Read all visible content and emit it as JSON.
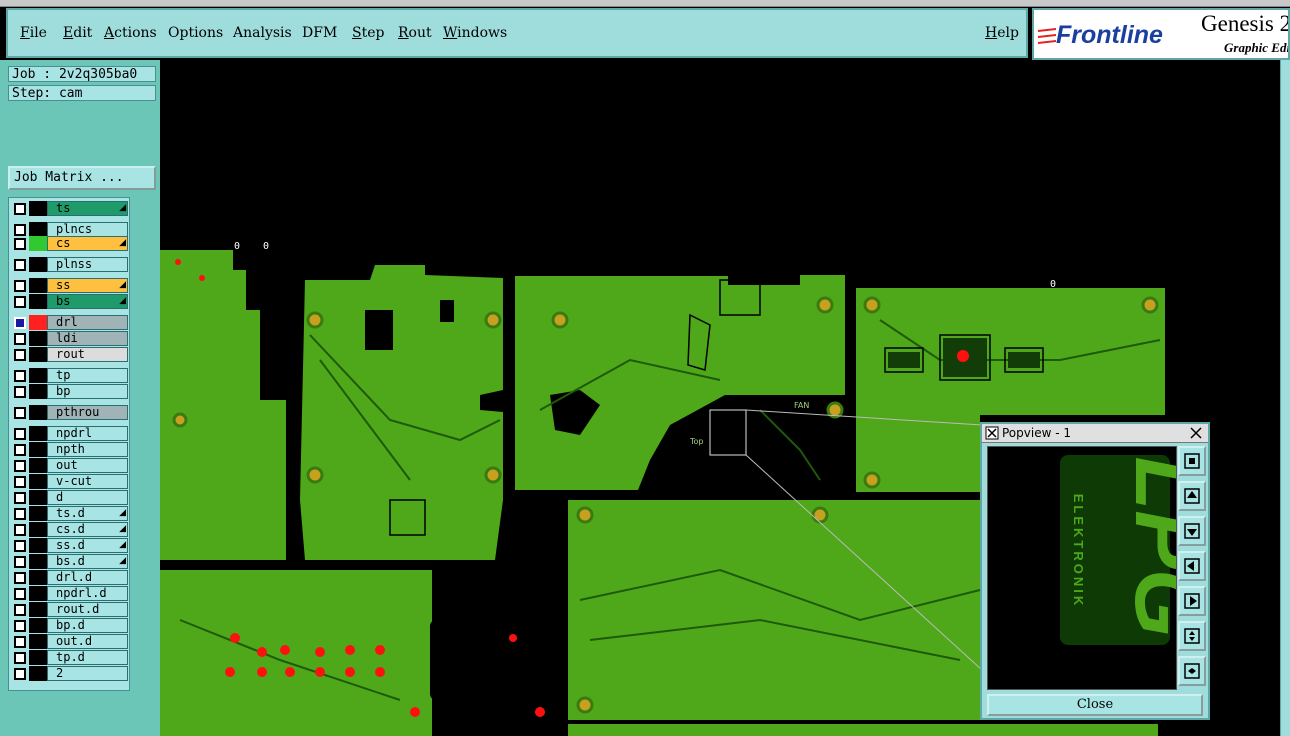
{
  "menubar": {
    "items": [
      {
        "label": "File"
      },
      {
        "label": "Edit"
      },
      {
        "label": "Actions"
      },
      {
        "label": "Options"
      },
      {
        "label": "Analysis"
      },
      {
        "label": "DFM"
      },
      {
        "label": "Step"
      },
      {
        "label": "Rout"
      },
      {
        "label": "Windows"
      }
    ],
    "help": "Help"
  },
  "brand": {
    "logo": "Frontline",
    "product": "Genesis 2",
    "subtitle": "Graphic Editor"
  },
  "job": {
    "label": "Job : 2v2q305ba0"
  },
  "step": {
    "label": "Step: cam"
  },
  "job_matrix_button": "Job Matrix ...",
  "layers": [
    {
      "name": "ts",
      "color": "#1f9a6a"
    },
    {
      "name": "plncs",
      "color": "#a8e4e4"
    },
    {
      "name": "cs",
      "color": "#ffc040",
      "swatch": "#32c832"
    },
    {
      "name": "plnss",
      "color": "#a8e4e4"
    },
    {
      "name": "ss",
      "color": "#ffc040"
    },
    {
      "name": "bs",
      "color": "#1f9a6a"
    },
    {
      "name": "drl",
      "color": "#a0b4b8",
      "swatch": "#ff2020"
    },
    {
      "name": "ldi",
      "color": "#a0b4b8"
    },
    {
      "name": "rout",
      "color": "#dcdcdc"
    },
    {
      "name": "tp",
      "color": "#a8e4e4"
    },
    {
      "name": "bp",
      "color": "#a8e4e4"
    },
    {
      "name": "pthrou",
      "color": "#a0b4b8"
    },
    {
      "name": "npdrl",
      "color": "#a8e4e4"
    },
    {
      "name": "npth",
      "color": "#a8e4e4"
    },
    {
      "name": "out",
      "color": "#a8e4e4"
    },
    {
      "name": "v-cut",
      "color": "#a8e4e4"
    },
    {
      "name": "d",
      "color": "#a8e4e4"
    },
    {
      "name": "ts.d",
      "color": "#a8e4e4"
    },
    {
      "name": "cs.d",
      "color": "#a8e4e4"
    },
    {
      "name": "ss.d",
      "color": "#a8e4e4"
    },
    {
      "name": "bs.d",
      "color": "#a8e4e4"
    },
    {
      "name": "drl.d",
      "color": "#a8e4e4"
    },
    {
      "name": "npdrl.d",
      "color": "#a8e4e4"
    },
    {
      "name": "rout.d",
      "color": "#a8e4e4"
    },
    {
      "name": "bp.d",
      "color": "#a8e4e4"
    },
    {
      "name": "out.d",
      "color": "#a8e4e4"
    },
    {
      "name": "tp.d",
      "color": "#a8e4e4"
    },
    {
      "name": "2",
      "color": "#a8e4e4"
    }
  ],
  "canvas": {
    "board_color": "#4fa819",
    "labels": {
      "top": "Top",
      "fan": "FAN",
      "zero_a": "0",
      "zero_b": "0",
      "zero_c": "0"
    }
  },
  "popview": {
    "title": "Popview - 1",
    "logo_mark": "LPG",
    "logo_text": "ELEKTRONIK",
    "close": "Close"
  }
}
